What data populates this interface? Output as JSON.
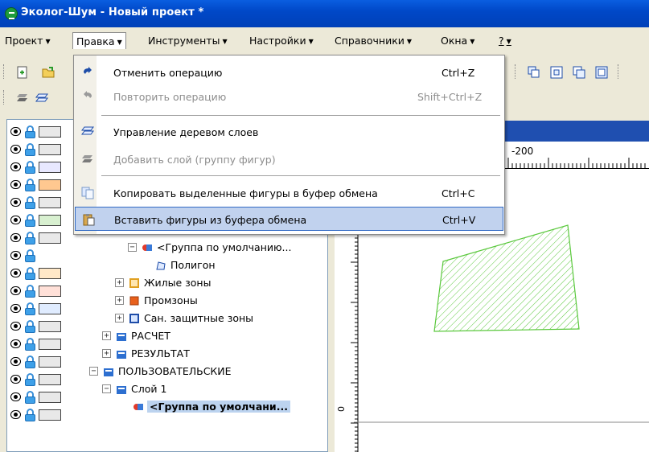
{
  "window": {
    "title": "Эколог-Шум - Новый проект *"
  },
  "menubar": {
    "items": [
      {
        "label": "Проект",
        "arrow": "▼"
      },
      {
        "label": "Правка",
        "arrow": "▼"
      },
      {
        "label": "Инструменты",
        "arrow": "▼"
      },
      {
        "label": "Настройки",
        "arrow": "▼"
      },
      {
        "label": "Справочники",
        "arrow": "▼"
      },
      {
        "label": "Окна",
        "arrow": "▼"
      },
      {
        "label": "?",
        "arrow": "▼"
      }
    ]
  },
  "edit_menu": {
    "items": [
      {
        "label": "Отменить операцию",
        "shortcut": "Ctrl+Z",
        "icon": "undo-icon",
        "enabled": true
      },
      {
        "label": "Повторить операцию",
        "shortcut": "Shift+Ctrl+Z",
        "icon": "redo-icon",
        "enabled": false
      },
      {
        "label": "Управление деревом слоев",
        "shortcut": "",
        "icon": "layers-icon",
        "enabled": true
      },
      {
        "label": "Добавить слой (группу фигур)",
        "shortcut": "",
        "icon": "add-layer-icon",
        "enabled": false
      },
      {
        "label": "Копировать выделенные фигуры в буфер обмена",
        "shortcut": "Ctrl+C",
        "icon": "copy-icon",
        "enabled": true
      },
      {
        "label": "Вставить фигуры из буфера обмена",
        "shortcut": "Ctrl+V",
        "icon": "paste-icon",
        "enabled": true,
        "highlighted": true
      }
    ]
  },
  "tree": {
    "nodes": [
      {
        "label": "<Группа по умолчанию...",
        "icon": "group-icon",
        "expander": "−"
      },
      {
        "label": "Полигон",
        "icon": "polygon-icon",
        "expander": ""
      },
      {
        "label": "Жилые зоны",
        "icon": "zone-icon",
        "expander": "+"
      },
      {
        "label": "Промзоны",
        "icon": "zone-icon",
        "expander": "+"
      },
      {
        "label": "Сан. защитные зоны",
        "icon": "zone-icon",
        "expander": "+"
      },
      {
        "label": "РАСЧЕТ",
        "icon": "folder-icon",
        "expander": "+"
      },
      {
        "label": "РЕЗУЛЬТАТ",
        "icon": "folder-icon",
        "expander": "+"
      },
      {
        "label": "ПОЛЬЗОВАТЕЛЬСКИЕ",
        "icon": "folder-icon",
        "expander": "−"
      },
      {
        "label": "Слой 1",
        "icon": "folder-icon",
        "expander": "−"
      },
      {
        "label": "<Группа по умолчани...",
        "icon": "group-icon",
        "expander": "",
        "selected": true
      }
    ]
  },
  "layer_rows": [
    {
      "swatch": "#e8e8e8"
    },
    {
      "swatch": "#e8e8e8"
    },
    {
      "swatch": "#e8e8ff"
    },
    {
      "swatch": "#ffc890"
    },
    {
      "swatch": "#e8e8e8"
    },
    {
      "swatch": "#d8f0d0"
    },
    {
      "swatch": "#e8e8e8"
    },
    {
      "swatch": ""
    },
    {
      "swatch": "#ffe8c8"
    },
    {
      "swatch": "#ffe0d8"
    },
    {
      "swatch": "#e0ecff"
    },
    {
      "swatch": "#e8e8e8"
    },
    {
      "swatch": "#e8e8e8"
    },
    {
      "swatch": "#e8e8e8"
    },
    {
      "swatch": "#e8e8e8"
    },
    {
      "swatch": "#e8e8e8"
    },
    {
      "swatch": "#e8e8e8"
    }
  ],
  "ruler": {
    "top_label": "-200",
    "left_label": "0"
  },
  "colors": {
    "title_blue": "#0a5ee0",
    "polygon_stroke": "#5ac83c",
    "menu_highlight": "#c1d2ee"
  }
}
